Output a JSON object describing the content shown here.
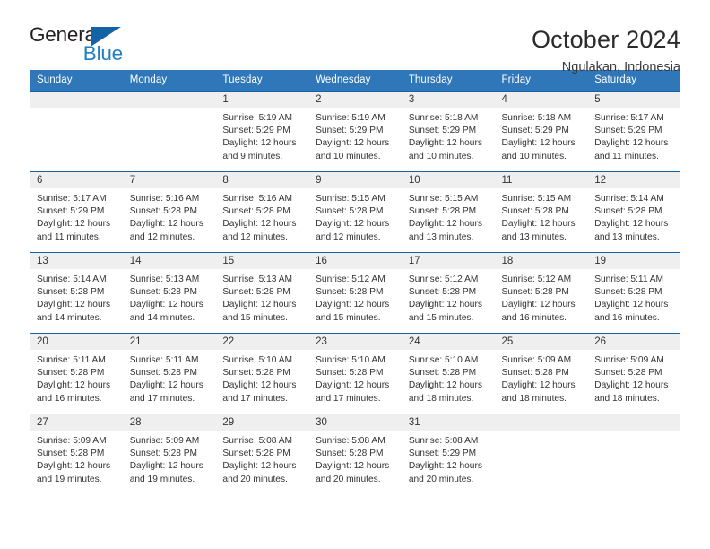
{
  "logo": {
    "name": "general-blue-logo",
    "text_top": "General",
    "text_bottom": "Blue",
    "color_dark": "#231f20",
    "color_blue": "#1f7ec4",
    "triangle_color": "#1464a5"
  },
  "header": {
    "title": "October 2024",
    "subtitle": "Ngulakan, Indonesia"
  },
  "theme": {
    "header_bar": "#2f77b8",
    "row_divider": "#1464a5",
    "daynum_band": "#efefef",
    "text": "#333333"
  },
  "weekdays": [
    "Sunday",
    "Monday",
    "Tuesday",
    "Wednesday",
    "Thursday",
    "Friday",
    "Saturday"
  ],
  "weeks": [
    [
      {
        "day": "",
        "sunrise": "",
        "sunset": "",
        "daylight": ""
      },
      {
        "day": "",
        "sunrise": "",
        "sunset": "",
        "daylight": ""
      },
      {
        "day": "1",
        "sunrise": "Sunrise: 5:19 AM",
        "sunset": "Sunset: 5:29 PM",
        "daylight": "Daylight: 12 hours and 9 minutes."
      },
      {
        "day": "2",
        "sunrise": "Sunrise: 5:19 AM",
        "sunset": "Sunset: 5:29 PM",
        "daylight": "Daylight: 12 hours and 10 minutes."
      },
      {
        "day": "3",
        "sunrise": "Sunrise: 5:18 AM",
        "sunset": "Sunset: 5:29 PM",
        "daylight": "Daylight: 12 hours and 10 minutes."
      },
      {
        "day": "4",
        "sunrise": "Sunrise: 5:18 AM",
        "sunset": "Sunset: 5:29 PM",
        "daylight": "Daylight: 12 hours and 10 minutes."
      },
      {
        "day": "5",
        "sunrise": "Sunrise: 5:17 AM",
        "sunset": "Sunset: 5:29 PM",
        "daylight": "Daylight: 12 hours and 11 minutes."
      }
    ],
    [
      {
        "day": "6",
        "sunrise": "Sunrise: 5:17 AM",
        "sunset": "Sunset: 5:29 PM",
        "daylight": "Daylight: 12 hours and 11 minutes."
      },
      {
        "day": "7",
        "sunrise": "Sunrise: 5:16 AM",
        "sunset": "Sunset: 5:28 PM",
        "daylight": "Daylight: 12 hours and 12 minutes."
      },
      {
        "day": "8",
        "sunrise": "Sunrise: 5:16 AM",
        "sunset": "Sunset: 5:28 PM",
        "daylight": "Daylight: 12 hours and 12 minutes."
      },
      {
        "day": "9",
        "sunrise": "Sunrise: 5:15 AM",
        "sunset": "Sunset: 5:28 PM",
        "daylight": "Daylight: 12 hours and 12 minutes."
      },
      {
        "day": "10",
        "sunrise": "Sunrise: 5:15 AM",
        "sunset": "Sunset: 5:28 PM",
        "daylight": "Daylight: 12 hours and 13 minutes."
      },
      {
        "day": "11",
        "sunrise": "Sunrise: 5:15 AM",
        "sunset": "Sunset: 5:28 PM",
        "daylight": "Daylight: 12 hours and 13 minutes."
      },
      {
        "day": "12",
        "sunrise": "Sunrise: 5:14 AM",
        "sunset": "Sunset: 5:28 PM",
        "daylight": "Daylight: 12 hours and 13 minutes."
      }
    ],
    [
      {
        "day": "13",
        "sunrise": "Sunrise: 5:14 AM",
        "sunset": "Sunset: 5:28 PM",
        "daylight": "Daylight: 12 hours and 14 minutes."
      },
      {
        "day": "14",
        "sunrise": "Sunrise: 5:13 AM",
        "sunset": "Sunset: 5:28 PM",
        "daylight": "Daylight: 12 hours and 14 minutes."
      },
      {
        "day": "15",
        "sunrise": "Sunrise: 5:13 AM",
        "sunset": "Sunset: 5:28 PM",
        "daylight": "Daylight: 12 hours and 15 minutes."
      },
      {
        "day": "16",
        "sunrise": "Sunrise: 5:12 AM",
        "sunset": "Sunset: 5:28 PM",
        "daylight": "Daylight: 12 hours and 15 minutes."
      },
      {
        "day": "17",
        "sunrise": "Sunrise: 5:12 AM",
        "sunset": "Sunset: 5:28 PM",
        "daylight": "Daylight: 12 hours and 15 minutes."
      },
      {
        "day": "18",
        "sunrise": "Sunrise: 5:12 AM",
        "sunset": "Sunset: 5:28 PM",
        "daylight": "Daylight: 12 hours and 16 minutes."
      },
      {
        "day": "19",
        "sunrise": "Sunrise: 5:11 AM",
        "sunset": "Sunset: 5:28 PM",
        "daylight": "Daylight: 12 hours and 16 minutes."
      }
    ],
    [
      {
        "day": "20",
        "sunrise": "Sunrise: 5:11 AM",
        "sunset": "Sunset: 5:28 PM",
        "daylight": "Daylight: 12 hours and 16 minutes."
      },
      {
        "day": "21",
        "sunrise": "Sunrise: 5:11 AM",
        "sunset": "Sunset: 5:28 PM",
        "daylight": "Daylight: 12 hours and 17 minutes."
      },
      {
        "day": "22",
        "sunrise": "Sunrise: 5:10 AM",
        "sunset": "Sunset: 5:28 PM",
        "daylight": "Daylight: 12 hours and 17 minutes."
      },
      {
        "day": "23",
        "sunrise": "Sunrise: 5:10 AM",
        "sunset": "Sunset: 5:28 PM",
        "daylight": "Daylight: 12 hours and 17 minutes."
      },
      {
        "day": "24",
        "sunrise": "Sunrise: 5:10 AM",
        "sunset": "Sunset: 5:28 PM",
        "daylight": "Daylight: 12 hours and 18 minutes."
      },
      {
        "day": "25",
        "sunrise": "Sunrise: 5:09 AM",
        "sunset": "Sunset: 5:28 PM",
        "daylight": "Daylight: 12 hours and 18 minutes."
      },
      {
        "day": "26",
        "sunrise": "Sunrise: 5:09 AM",
        "sunset": "Sunset: 5:28 PM",
        "daylight": "Daylight: 12 hours and 18 minutes."
      }
    ],
    [
      {
        "day": "27",
        "sunrise": "Sunrise: 5:09 AM",
        "sunset": "Sunset: 5:28 PM",
        "daylight": "Daylight: 12 hours and 19 minutes."
      },
      {
        "day": "28",
        "sunrise": "Sunrise: 5:09 AM",
        "sunset": "Sunset: 5:28 PM",
        "daylight": "Daylight: 12 hours and 19 minutes."
      },
      {
        "day": "29",
        "sunrise": "Sunrise: 5:08 AM",
        "sunset": "Sunset: 5:28 PM",
        "daylight": "Daylight: 12 hours and 20 minutes."
      },
      {
        "day": "30",
        "sunrise": "Sunrise: 5:08 AM",
        "sunset": "Sunset: 5:28 PM",
        "daylight": "Daylight: 12 hours and 20 minutes."
      },
      {
        "day": "31",
        "sunrise": "Sunrise: 5:08 AM",
        "sunset": "Sunset: 5:29 PM",
        "daylight": "Daylight: 12 hours and 20 minutes."
      },
      {
        "day": "",
        "sunrise": "",
        "sunset": "",
        "daylight": ""
      },
      {
        "day": "",
        "sunrise": "",
        "sunset": "",
        "daylight": ""
      }
    ]
  ]
}
